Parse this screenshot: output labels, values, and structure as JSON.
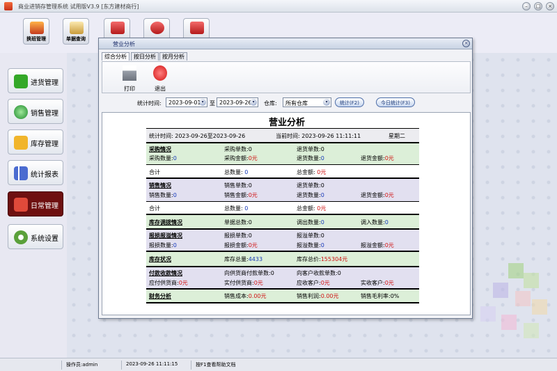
{
  "app": {
    "title": "商业进销存管理系统 试用版V3.9 [东方建材商行]"
  },
  "toolbar": {
    "buttons": [
      {
        "label": "换班管理",
        "icon": "user-swap-icon"
      },
      {
        "label": "单据查询",
        "icon": "magnifier-icon"
      },
      {
        "label": "",
        "icon": "bar-chart-icon"
      },
      {
        "label": "",
        "icon": "help-icon"
      },
      {
        "label": "",
        "icon": "power-icon"
      }
    ]
  },
  "sidebar": {
    "items": [
      {
        "label": "进货管理",
        "icon": "plus-icon",
        "active": false
      },
      {
        "label": "销售管理",
        "icon": "globe-icon",
        "active": false
      },
      {
        "label": "库存管理",
        "icon": "star-icon",
        "active": false
      },
      {
        "label": "统计报表",
        "icon": "chart-icon",
        "active": false
      },
      {
        "label": "日常管理",
        "icon": "tools-icon",
        "active": true
      },
      {
        "label": "系统设置",
        "icon": "gear-icon",
        "active": false
      }
    ]
  },
  "dialog": {
    "title": "营业分析",
    "tabs": [
      "综合分析",
      "按日分析",
      "按月分析"
    ],
    "actions": {
      "print": "打印",
      "exit": "退出"
    },
    "filter": {
      "period_label": "统计时间:",
      "start": "2023-09-01",
      "to_label": "至",
      "end": "2023-09-26",
      "warehouse_label": "仓库:",
      "warehouse": "所有仓库",
      "stat_button": "统计(F2)",
      "today_button": "今日统计(F3)"
    }
  },
  "report": {
    "title": "营业分析",
    "period": "统计时间: 2023-09-26至2023-09-26",
    "now": "当前时间: 2023-09-26 11:11:11",
    "weekday": "星期二",
    "purchase": {
      "title": "采购情况",
      "orders_label": "采购单数:",
      "orders": "0",
      "returns_label": "退货单数:",
      "returns": "0",
      "qty_label": "采购数量:",
      "qty": "0",
      "amount_label": "采购金额:",
      "amount": "0元",
      "ret_qty_label": "退货数量:",
      "ret_qty": "0",
      "ret_amount_label": "退货金额:",
      "ret_amount": "0元",
      "total_label": "合计",
      "total_qty_label": "总数量:",
      "total_qty": "0",
      "total_amount_label": "总金额:",
      "total_amount": "0元"
    },
    "sales": {
      "title": "销售情况",
      "orders_label": "销售单数:",
      "orders": "0",
      "returns_label": "退货单数:",
      "returns": "0",
      "qty_label": "销售数量:",
      "qty": "0",
      "amount_label": "销售金额:",
      "amount": "0元",
      "ret_qty_label": "退货数量:",
      "ret_qty": "0",
      "ret_amount_label": "退货金额:",
      "ret_amount": "0元",
      "total_label": "合计",
      "total_qty_label": "总数量:",
      "total_qty": "0",
      "total_amount_label": "总金额:",
      "total_amount": "0元"
    },
    "transfer": {
      "title": "库存调拨情况",
      "docs_label": "单据总数:",
      "docs": "0",
      "out_label": "调出数量:",
      "out": "0",
      "in_label": "调入数量:",
      "in": "0"
    },
    "damage": {
      "title": "报损报溢情况",
      "loss_orders_label": "报损单数:",
      "loss_orders": "0",
      "gain_orders_label": "报溢单数:",
      "gain_orders": "0",
      "loss_qty_label": "报损数量:",
      "loss_qty": "0",
      "loss_amount_label": "报损金额:",
      "loss_amount": "0元",
      "gain_qty_label": "报溢数量:",
      "gain_qty": "0",
      "gain_amount_label": "报溢金额:",
      "gain_amount": "0元"
    },
    "inventory": {
      "title": "库存状况",
      "total_label": "库存总量:",
      "total": "4433",
      "value_label": "库存总价:",
      "value": "155304元"
    },
    "payments": {
      "title": "付款收款情况",
      "pay_orders_label": "向供货商付款单数:",
      "pay_orders": "0",
      "rec_orders_label": "向客户收款单数:",
      "rec_orders": "0",
      "payable_label": "应付供货商:",
      "payable": "0元",
      "paid_label": "实付供货商:",
      "paid": "0元",
      "receivable_label": "应收客户:",
      "receivable": "0元",
      "received_label": "实收客户:",
      "received": "0元"
    },
    "finance": {
      "title": "财务分析",
      "cost_label": "销售成本:",
      "cost": "0.00元",
      "profit_label": "销售利润:",
      "profit": "0.00元",
      "margin_label": "销售毛利率:",
      "margin": "0%"
    }
  },
  "status": {
    "operator": "操作员:admin",
    "datetime": "2023-09-26 11:11:15",
    "help": "按F1查看帮助文档"
  }
}
